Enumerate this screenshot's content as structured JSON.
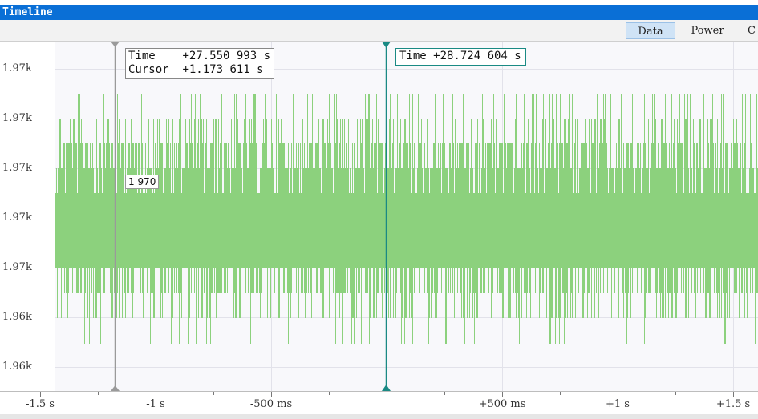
{
  "window": {
    "title": "Timeline"
  },
  "tabs": [
    {
      "label": "Data",
      "selected": true
    },
    {
      "label": "Power",
      "selected": false
    },
    {
      "label": "C",
      "selected": false
    }
  ],
  "y_axis": {
    "labels": [
      "1.97k",
      "1.97k",
      "1.97k",
      "1.97k",
      "1.97k",
      "1.96k",
      "1.96k"
    ]
  },
  "x_axis": {
    "labels": [
      "-1.5 s",
      "-1 s",
      "-500 ms",
      "+500 ms",
      "+1 s",
      "+1.5 s"
    ]
  },
  "cursor_tooltip": {
    "time_label": "Time",
    "time_value": "+27.550 993 s",
    "cursor_label": "Cursor",
    "cursor_value": "+1.173 611 s"
  },
  "marker_tooltip": {
    "text": "Time +28.724 604 s"
  },
  "value_tooltip": {
    "text": "1 970"
  },
  "colors": {
    "signal": "#8cd17d",
    "marker": "#1a8a84",
    "cursor": "#9a9a9a",
    "title_bar": "#0a6fd6",
    "plot_bg": "#f8f8fb"
  }
}
